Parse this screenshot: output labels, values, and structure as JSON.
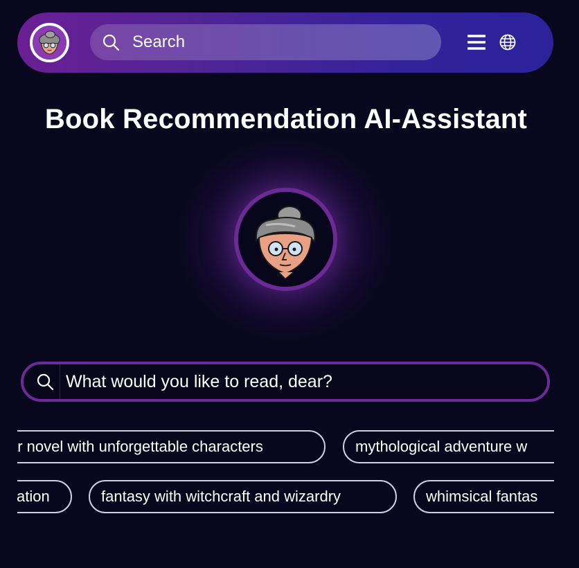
{
  "header": {
    "search_placeholder": "Search"
  },
  "page": {
    "title": "Book Recommendation AI-Assistant"
  },
  "query": {
    "placeholder": "What would you like to read, dear?"
  },
  "suggestions": {
    "row1": [
      "ar novel with unforgettable characters",
      "mythological adventure w"
    ],
    "row2": [
      "cation",
      "fantasy with witchcraft and wizardry",
      "whimsical fantas"
    ]
  },
  "icons": {
    "search": "search-icon",
    "menu": "hamburger-menu-icon",
    "language": "globe-icon"
  },
  "colors": {
    "background": "#08071e",
    "accent_purple": "#6d2a98",
    "nav_gradient_start": "#6a1f93",
    "nav_gradient_end": "#2b229a"
  }
}
